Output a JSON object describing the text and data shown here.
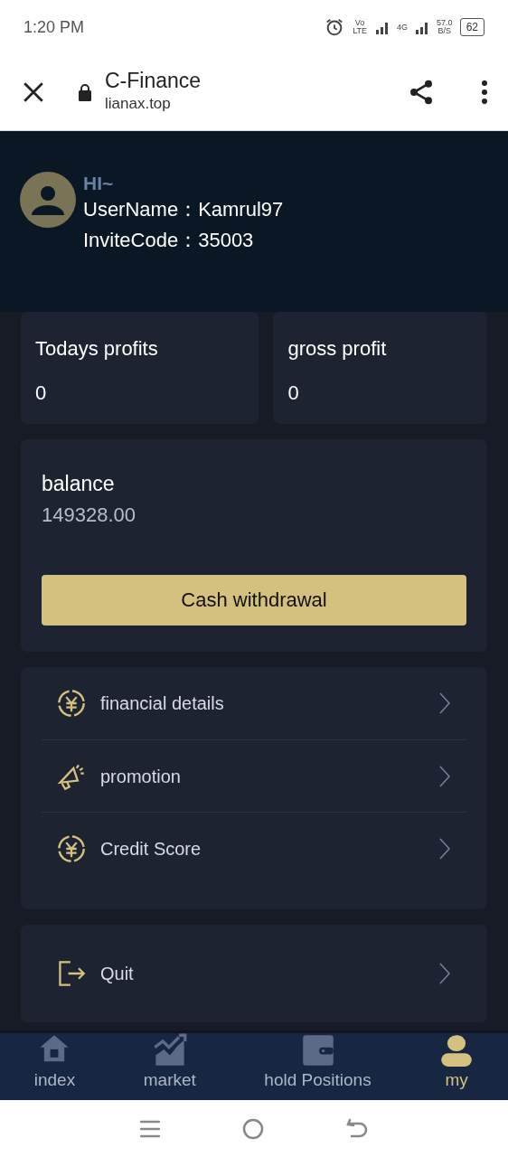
{
  "status_bar": {
    "time": "1:20 PM",
    "volte": "Vo LTE",
    "network": "4G",
    "speed": "57.0",
    "speed_unit": "B/S",
    "battery": "62"
  },
  "browser": {
    "title": "C-Finance",
    "url": "lianax.top"
  },
  "profile": {
    "greeting": "HI~",
    "username": "UserName：Kamrul97",
    "invite_code": "InviteCode：35003"
  },
  "stats": [
    {
      "label": "Todays profits",
      "value": "0"
    },
    {
      "label": "gross profit",
      "value": "0"
    }
  ],
  "balance": {
    "label": "balance",
    "value": "149328.00",
    "button": "Cash withdrawal"
  },
  "menu": [
    {
      "kind": "yen",
      "label": "financial details"
    },
    {
      "kind": "megaphone",
      "label": "promotion"
    },
    {
      "kind": "yen",
      "label": "Credit Score"
    }
  ],
  "quit": {
    "kind": "exit",
    "label": "Quit"
  },
  "tabs": [
    {
      "kind": "home",
      "label": "index",
      "selected": false
    },
    {
      "kind": "chart",
      "label": "market",
      "selected": false
    },
    {
      "kind": "wallet",
      "label": "hold Positions",
      "selected": false
    },
    {
      "kind": "user",
      "label": "my",
      "selected": true
    }
  ]
}
